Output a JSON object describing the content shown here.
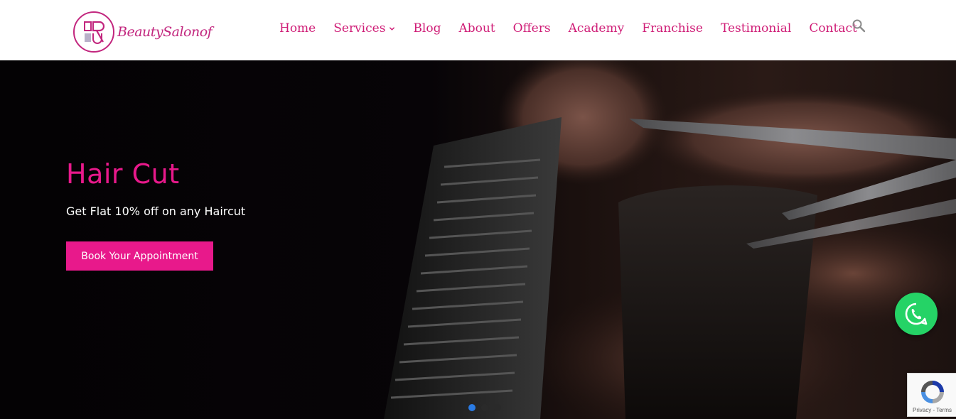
{
  "brand": {
    "name": "BeautySalonof",
    "accent_color": "#cf1c76",
    "logo_icon": "salon-monogram-icon"
  },
  "nav": {
    "items": [
      {
        "label": "Home"
      },
      {
        "label": "Services",
        "has_dropdown": true
      },
      {
        "label": "Blog"
      },
      {
        "label": "About"
      },
      {
        "label": "Offers"
      },
      {
        "label": "Academy"
      },
      {
        "label": "Franchise"
      },
      {
        "label": "Testimonial"
      },
      {
        "label": "Contact"
      }
    ],
    "search_icon": "search-icon"
  },
  "hero": {
    "title": "Hair Cut",
    "subtitle": "Get Flat 10% off on any Haircut",
    "cta_label": "Book Your Appointment",
    "title_color": "#e8198b",
    "cta_color": "#e8198b",
    "slides": {
      "count": 3,
      "active_index": 0
    },
    "background": "scissors-and-comb-cutting-hair-photo"
  },
  "widgets": {
    "whatsapp_icon": "whatsapp-icon",
    "whatsapp_color": "#25d366",
    "recaptcha_text": "Privacy - Terms"
  }
}
